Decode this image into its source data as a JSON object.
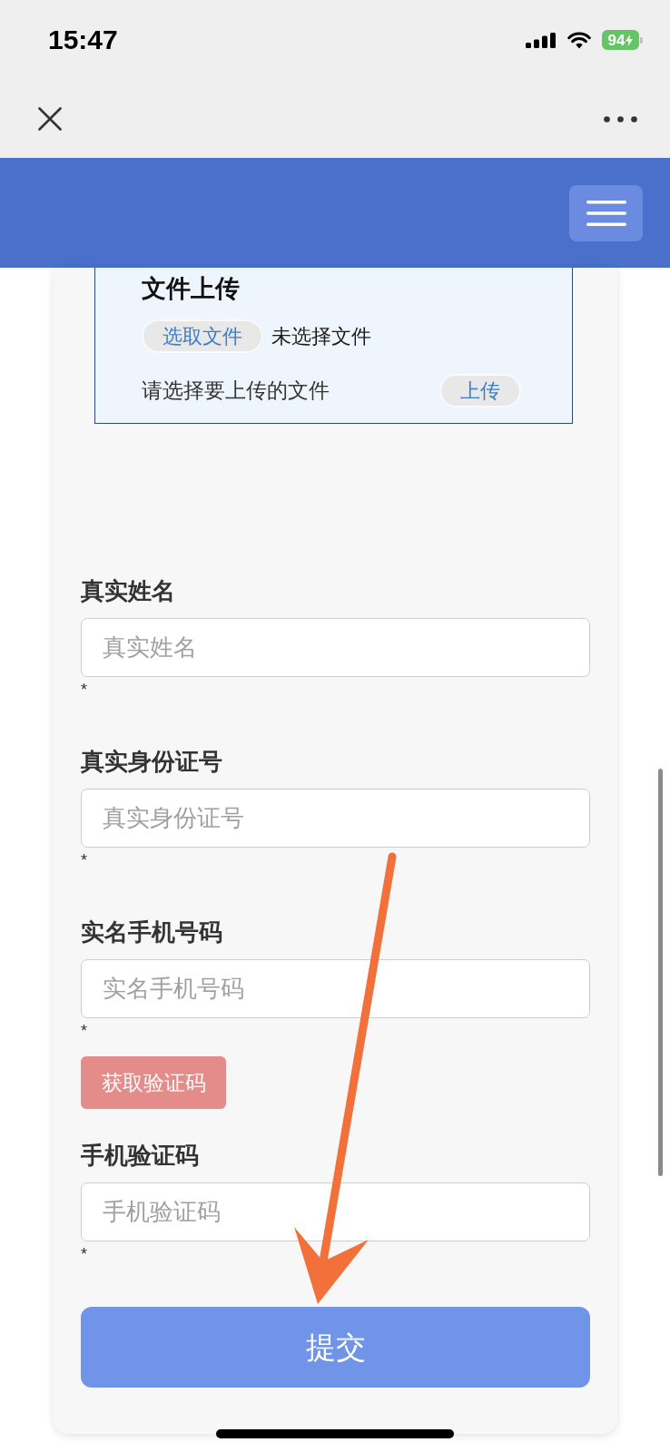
{
  "status_bar": {
    "time": "15:47",
    "battery": "94"
  },
  "upload_panel": {
    "title": "文件上传",
    "choose_button": "选取文件",
    "file_status": "未选择文件",
    "hint": "请选择要上传的文件",
    "upload_button": "上传"
  },
  "form": {
    "items": [
      {
        "kind": "field",
        "label": "真实姓名",
        "placeholder": "真实姓名",
        "required_mark": "*"
      },
      {
        "kind": "field",
        "label": "真实身份证号",
        "placeholder": "真实身份证号",
        "required_mark": "*"
      },
      {
        "kind": "field",
        "label": "实名手机号码",
        "placeholder": "实名手机号码",
        "required_mark": "*"
      },
      {
        "kind": "button",
        "label": "获取验证码",
        "disabled": true
      },
      {
        "kind": "field",
        "label": "手机验证码",
        "placeholder": "手机验证码",
        "required_mark": "*"
      }
    ],
    "submit_button": "提交"
  }
}
